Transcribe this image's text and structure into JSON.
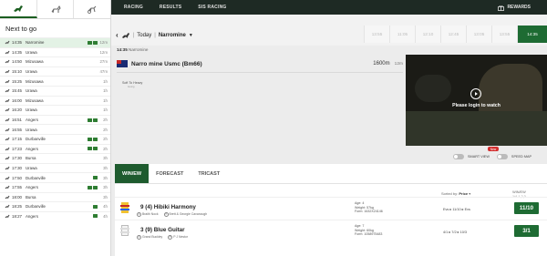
{
  "sport_tabs": [
    {
      "name": "horse-racing",
      "icon": "horse-racing-icon"
    },
    {
      "name": "greyhounds",
      "icon": "greyhound-icon"
    },
    {
      "name": "harness",
      "icon": "harness-racing-icon"
    }
  ],
  "sidebar": {
    "title": "Next to go",
    "races": [
      {
        "time": "14:35",
        "venue": "Narromine",
        "eta": "12m",
        "badges": 2,
        "selected": true
      },
      {
        "time": "14:35",
        "venue": "Urawa",
        "eta": "12m",
        "badges": 0
      },
      {
        "time": "14:50",
        "venue": "Mizusawa",
        "eta": "27m",
        "badges": 0
      },
      {
        "time": "15:10",
        "venue": "Urawa",
        "eta": "47m",
        "badges": 0
      },
      {
        "time": "15:25",
        "venue": "Mizusawa",
        "eta": "1h",
        "badges": 0
      },
      {
        "time": "15:45",
        "venue": "Urawa",
        "eta": "1h",
        "badges": 0
      },
      {
        "time": "16:00",
        "venue": "Mizusawa",
        "eta": "1h",
        "badges": 0
      },
      {
        "time": "16:20",
        "venue": "Urawa",
        "eta": "1h",
        "badges": 0
      },
      {
        "time": "16:51",
        "venue": "Angers",
        "eta": "2h",
        "badges": 2
      },
      {
        "time": "16:55",
        "venue": "Urawa",
        "eta": "2h",
        "badges": 0
      },
      {
        "time": "17:15",
        "venue": "Durbanville",
        "eta": "2h",
        "badges": 2
      },
      {
        "time": "17:23",
        "venue": "Angers",
        "eta": "2h",
        "badges": 2
      },
      {
        "time": "17:30",
        "venue": "Bursa",
        "eta": "3h",
        "badges": 0
      },
      {
        "time": "17:30",
        "venue": "Urawa",
        "eta": "3h",
        "badges": 0
      },
      {
        "time": "17:50",
        "venue": "Durbanville",
        "eta": "3h",
        "badges": 1
      },
      {
        "time": "17:55",
        "venue": "Angers",
        "eta": "3h",
        "badges": 2
      },
      {
        "time": "18:00",
        "venue": "Bursa",
        "eta": "3h",
        "badges": 0
      },
      {
        "time": "18:25",
        "venue": "Durbanville",
        "eta": "4h",
        "badges": 1
      },
      {
        "time": "18:27",
        "venue": "Angers",
        "eta": "4h",
        "badges": 1
      }
    ]
  },
  "topnav": {
    "links": [
      "RACING",
      "RESULTS",
      "SIS RACING"
    ],
    "rewards_label": "REWARDS"
  },
  "header": {
    "day": "Today",
    "course": "Narromine",
    "times": [
      "13:55",
      "11:05",
      "12:10",
      "12:45",
      "13:05",
      "13:55",
      "14:35"
    ],
    "active_time": "14:35"
  },
  "subtitle": {
    "time": "14:35",
    "course": "Narromine"
  },
  "race": {
    "name": "Narro mine Usmc (Bm66)",
    "distance": "1600m",
    "duration": "12m",
    "going": "Soft To Heavy",
    "going_sub": "Going"
  },
  "video": {
    "message": "Please login to watch"
  },
  "toggles": {
    "smart_view": "SMART VIEW",
    "speed_map": "SPEED MAP",
    "new_label": "New"
  },
  "market": {
    "tabs": [
      "WIN/EW",
      "FORECAST",
      "TRICAST"
    ],
    "sort_label": "Sorted by:",
    "sort_value": "Price",
    "column_head": "WIN/EW",
    "column_sub": "1/4 1,2,3",
    "runners": [
      {
        "name": "9 (4) Hibiki Harmony",
        "jockey": "Braith Nock",
        "trainer": "Brett & Georgie Cavanough",
        "age": "Age: 4",
        "weight": "Weight: 57kg",
        "form": "Form: 1632X24146",
        "odds_history": "Evs ▸ 11/10 ▸ Evs",
        "price": "11/10",
        "silk": "colour"
      },
      {
        "name": "3 (9) Blue Guitar",
        "jockey": "Grand Buckley",
        "trainer": "P J Nestor",
        "age": "Age: 7",
        "weight": "Weight: 60kg",
        "form": "Form: 1058975483",
        "odds_history": "4/1 ▸ 7/2 ▸ 10/3",
        "price": "3/1",
        "silk": "white"
      }
    ]
  },
  "colors": {
    "accent": "#1e6b33",
    "nav_bg": "#1e2a24",
    "badge_new": "#d32f2f"
  }
}
